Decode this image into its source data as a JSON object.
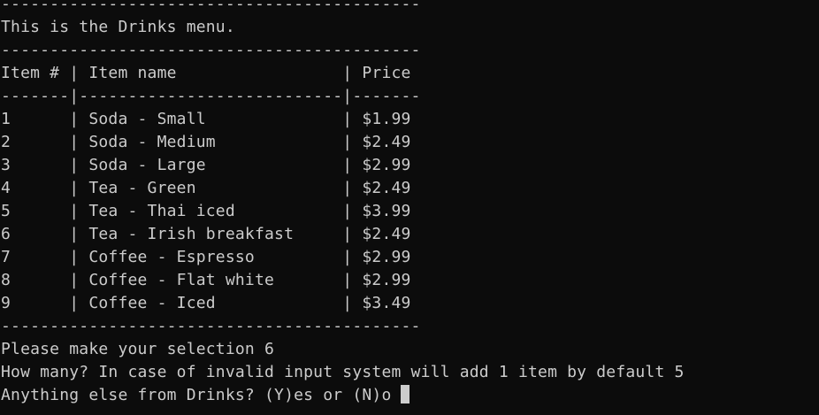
{
  "terminal": {
    "lines": [
      "-------------------------------------------",
      "This is the Drinks menu.",
      "-------------------------------------------",
      "Item # | Item name                 | Price",
      "-------|---------------------------|-------",
      "1      | Soda - Small              | $1.99",
      "2      | Soda - Medium             | $2.49",
      "3      | Soda - Large              | $2.99",
      "4      | Tea - Green               | $2.49",
      "5      | Tea - Thai iced           | $3.99",
      "6      | Tea - Irish breakfast     | $2.49",
      "7      | Coffee - Espresso         | $2.99",
      "8      | Coffee - Flat white       | $2.99",
      "9      | Coffee - Iced             | $3.49",
      "-------------------------------------------",
      "Please make your selection 6",
      "How many? In case of invalid input system will add 1 item by default 5",
      "Anything else from Drinks? (Y)es or (N)o"
    ]
  }
}
